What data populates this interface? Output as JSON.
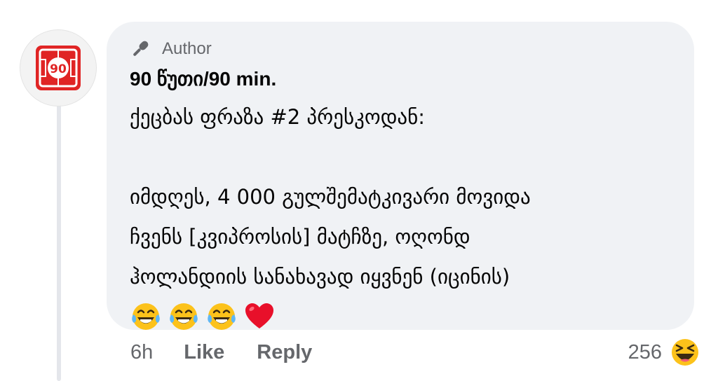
{
  "comment": {
    "avatar_badge_text": "90",
    "badge_label": "Author",
    "author_name": "90 წუთი/90 min.",
    "text_lines": [
      "ქეცბას ფრაზა #2 პრესკოდან:",
      "",
      "იმდღეს, 4 000 გულშემატკივარი მოვიდა",
      "ჩვენს [კვიპროსის] მატჩზე, ოღონდ",
      "ჰოლანდიის სანახავად იყვნენ (იცინის)"
    ],
    "emojis": [
      "tears-of-joy-emoji",
      "tears-of-joy-emoji",
      "tears-of-joy-emoji",
      "red-heart-emoji"
    ]
  },
  "actions": {
    "time": "6h",
    "like_label": "Like",
    "reply_label": "Reply"
  },
  "reactions": {
    "count": "256",
    "icon": "laughing-emoji"
  },
  "colors": {
    "bubble": "#f0f2f5",
    "secondary_text": "#65676b",
    "brand_red": "#e02424",
    "heart_red": "#e8102a",
    "emoji_yellow": "#fcc21b"
  }
}
